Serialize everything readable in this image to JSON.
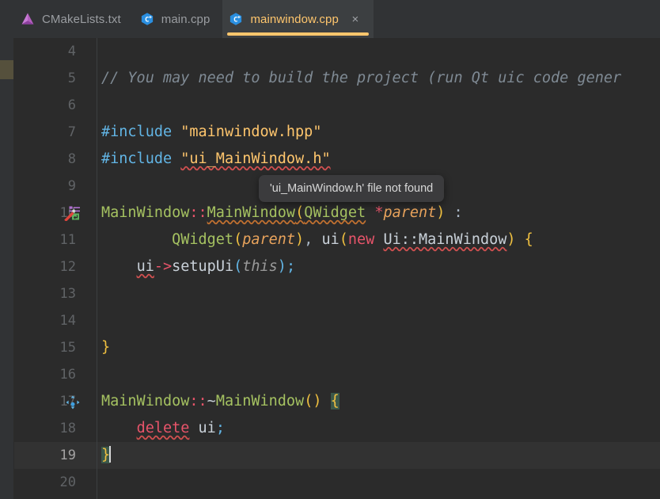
{
  "window": {
    "background": "#2b2b2b",
    "accent": "#ffc66d"
  },
  "tabbar": {
    "tabs": [
      {
        "label": "CMakeLists.txt",
        "icon": "cmake-icon",
        "active": false,
        "closable": false
      },
      {
        "label": "main.cpp",
        "icon": "cpp-file-icon",
        "active": false,
        "closable": false
      },
      {
        "label": "mainwindow.cpp",
        "icon": "cpp-file-icon",
        "active": true,
        "closable": true,
        "close_glyph": "×"
      }
    ]
  },
  "tooltip": {
    "text": "'ui_MainWindow.h' file not found"
  },
  "editor": {
    "current_line": 19,
    "lines": [
      {
        "num": "4",
        "gutter_icon": null
      },
      {
        "num": "5",
        "gutter_icon": null
      },
      {
        "num": "6",
        "gutter_icon": null
      },
      {
        "num": "7",
        "gutter_icon": null
      },
      {
        "num": "8",
        "gutter_icon": null
      },
      {
        "num": "9",
        "gutter_icon": null
      },
      {
        "num": "10",
        "gutter_icon": "implement-method-icon"
      },
      {
        "num": "11",
        "gutter_icon": null
      },
      {
        "num": "12",
        "gutter_icon": null
      },
      {
        "num": "13",
        "gutter_icon": null
      },
      {
        "num": "14",
        "gutter_icon": null
      },
      {
        "num": "15",
        "gutter_icon": null
      },
      {
        "num": "16",
        "gutter_icon": null
      },
      {
        "num": "17",
        "gutter_icon": "related-symbol-icon"
      },
      {
        "num": "18",
        "gutter_icon": null
      },
      {
        "num": "19",
        "gutter_icon": null
      },
      {
        "num": "20",
        "gutter_icon": null
      }
    ],
    "code": {
      "l4": "",
      "l5_comment": "// You may need to build the project (run Qt uic code gener",
      "l7_directive": "#include",
      "l7_string": "\"mainwindow.hpp\"",
      "l8_directive": "#include",
      "l8_string": "\"ui_MainWindow.h\"",
      "l10_a": "MainWindow",
      "l10_colons": "::",
      "l10_b": "MainWindow",
      "l10_paren": "(",
      "l10_type": "QWidget",
      "l10_star": "*",
      "l10_param": "parent",
      "l10_close": ")",
      "l10_trailing": " :",
      "l11_indent": "        ",
      "l11_type": "QWidget",
      "l11_open": "(",
      "l11_param": "parent",
      "l11_close": ")",
      "l11_comma": ",",
      "l11_member": "ui",
      "l11_open2": "(",
      "l11_new": "new",
      "l11_class": "Ui::MainWindow",
      "l11_close2": ")",
      "l11_brace": "{",
      "l12_indent": "    ",
      "l12_obj": "ui",
      "l12_arrow": "->",
      "l12_call": "setupUi",
      "l12_open": "(",
      "l12_this": "this",
      "l12_close": ")",
      "l12_semi": ";",
      "l15_brace": "}",
      "l17_a": "MainWindow",
      "l17_colons": "::",
      "l17_tilde": "~",
      "l17_b": "MainWindow",
      "l17_parens": "()",
      "l17_brace": "{",
      "l18_indent": "    ",
      "l18_kw": "delete",
      "l18_obj": " ui",
      "l18_semi": ";",
      "l19_brace": "}"
    }
  }
}
